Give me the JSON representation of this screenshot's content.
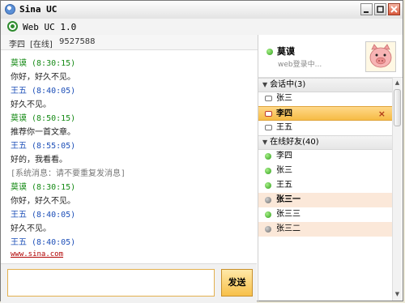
{
  "window": {
    "title": "Sina UC"
  },
  "app": {
    "version_label": "Web UC 1.0"
  },
  "chat": {
    "peer_name": "李四",
    "peer_status": "[在线]",
    "peer_id": "9527588",
    "messages": [
      {
        "text": "莫谟 (8:30:15)",
        "kind": "sender-self"
      },
      {
        "text": "你好，好久不见。",
        "kind": "body"
      },
      {
        "text": "王五 (8:40:05)",
        "kind": "sender-other"
      },
      {
        "text": "好久不见。",
        "kind": "body"
      },
      {
        "text": "莫谟 (8:50:15)",
        "kind": "sender-self"
      },
      {
        "text": "推荐你一首文章。",
        "kind": "body"
      },
      {
        "text": "王五 (8:55:05)",
        "kind": "sender-other"
      },
      {
        "text": "好的，我看看。",
        "kind": "body"
      },
      {
        "text": "[系统消息：请不要重复发消息]",
        "kind": "system"
      },
      {
        "text": "莫谟 (8:30:15)",
        "kind": "sender-self"
      },
      {
        "text": "你好，好久不见。",
        "kind": "body"
      },
      {
        "text": "王五 (8:40:05)",
        "kind": "sender-other"
      },
      {
        "text": "好久不见。",
        "kind": "body"
      },
      {
        "text": "王五 (8:40:05)",
        "kind": "sender-other"
      },
      {
        "text": "www.sina.com",
        "kind": "link"
      }
    ],
    "send_label": "发送"
  },
  "me": {
    "name": "莫谟",
    "status": "web登录中..."
  },
  "groups": {
    "active": {
      "label": "会话中",
      "count": "(3)",
      "items": [
        {
          "name": "张三",
          "icon": "chat-bubble-icon"
        },
        {
          "name": "李四",
          "icon": "chat-bubble-icon",
          "selected": true
        },
        {
          "name": "王五",
          "icon": "chat-bubble-icon"
        }
      ]
    },
    "online": {
      "label": "在线好友",
      "count": "(40)",
      "items": [
        {
          "name": "李四",
          "status": "online"
        },
        {
          "name": "张三",
          "status": "online"
        },
        {
          "name": "王五",
          "status": "online"
        },
        {
          "name": "张三一",
          "status": "away"
        },
        {
          "name": "张三三",
          "status": "online"
        },
        {
          "name": "张三二",
          "status": "away"
        }
      ]
    }
  },
  "close_mark": "×",
  "colors": {
    "accent": "#f6bb45",
    "online": "#2f9e1a",
    "self_name": "#158a15",
    "other_name": "#1d4fb8"
  }
}
